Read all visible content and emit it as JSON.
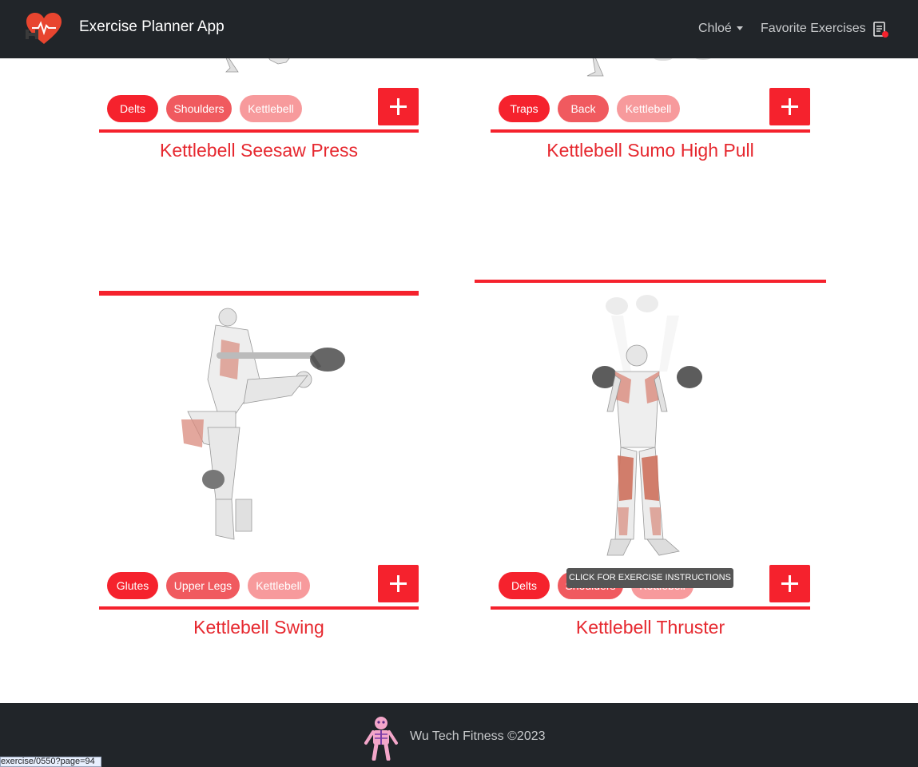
{
  "navbar": {
    "brand": "Exercise Planner App",
    "user_menu": "Chloé",
    "favorites_link": "Favorite Exercises",
    "brand_icon": "heart-dumbbell-icon",
    "favorites_icon": "clipboard-heart-icon"
  },
  "cards": [
    {
      "tags": [
        "Delts",
        "Shoulders",
        "Kettlebell"
      ],
      "title": "Kettlebell Seesaw Press"
    },
    {
      "tags": [
        "Traps",
        "Back",
        "Kettlebell"
      ],
      "title": "Kettlebell Sumo High Pull"
    },
    {
      "tags": [
        "Glutes",
        "Upper Legs",
        "Kettlebell"
      ],
      "title": "Kettlebell Swing"
    },
    {
      "tags": [
        "Delts",
        "Shoulders",
        "Kettlebell"
      ],
      "title": "Kettlebell Thruster"
    }
  ],
  "tooltip": "CLICK FOR EXERCISE INSTRUCTIONS",
  "footer": {
    "text": "Wu Tech Fitness ©2023",
    "logo_icon": "skeleton-icon"
  },
  "status_bar": {
    "url": "exercise/0550?page=94"
  },
  "colors": {
    "accent": "#f5222d",
    "nav_bg": "#212529",
    "title": "#e6282f"
  }
}
